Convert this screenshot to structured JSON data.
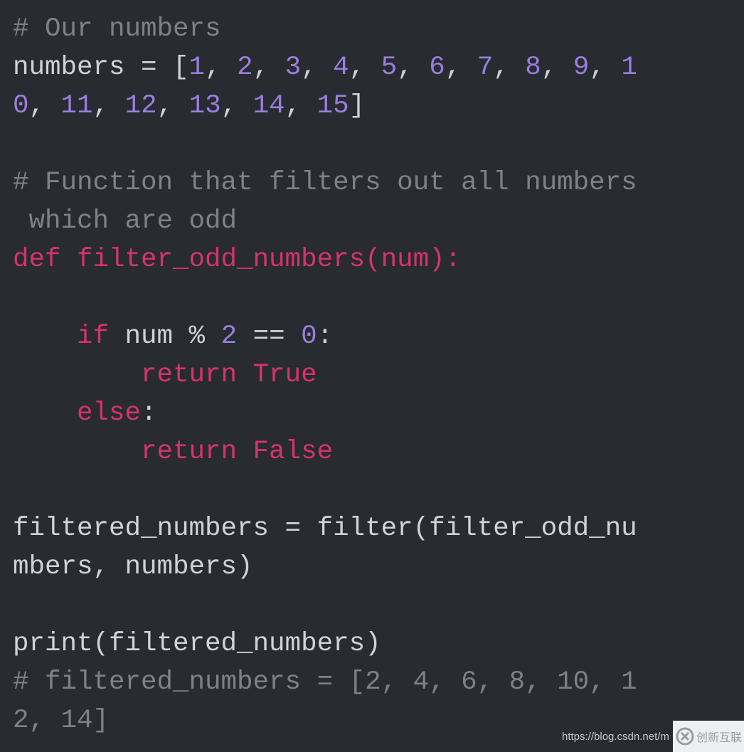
{
  "code_lines": [
    [
      {
        "t": "# Our numbers",
        "c": "cm"
      }
    ],
    [
      {
        "t": "numbers = [",
        "c": "pl"
      },
      {
        "t": "1",
        "c": "nm"
      },
      {
        "t": ", ",
        "c": "pl"
      },
      {
        "t": "2",
        "c": "nm"
      },
      {
        "t": ", ",
        "c": "pl"
      },
      {
        "t": "3",
        "c": "nm"
      },
      {
        "t": ", ",
        "c": "pl"
      },
      {
        "t": "4",
        "c": "nm"
      },
      {
        "t": ", ",
        "c": "pl"
      },
      {
        "t": "5",
        "c": "nm"
      },
      {
        "t": ", ",
        "c": "pl"
      },
      {
        "t": "6",
        "c": "nm"
      },
      {
        "t": ", ",
        "c": "pl"
      },
      {
        "t": "7",
        "c": "nm"
      },
      {
        "t": ", ",
        "c": "pl"
      },
      {
        "t": "8",
        "c": "nm"
      },
      {
        "t": ", ",
        "c": "pl"
      },
      {
        "t": "9",
        "c": "nm"
      },
      {
        "t": ", ",
        "c": "pl"
      },
      {
        "t": "1",
        "c": "nm"
      }
    ],
    [
      {
        "t": "0",
        "c": "nm"
      },
      {
        "t": ", ",
        "c": "pl"
      },
      {
        "t": "11",
        "c": "nm"
      },
      {
        "t": ", ",
        "c": "pl"
      },
      {
        "t": "12",
        "c": "nm"
      },
      {
        "t": ", ",
        "c": "pl"
      },
      {
        "t": "13",
        "c": "nm"
      },
      {
        "t": ", ",
        "c": "pl"
      },
      {
        "t": "14",
        "c": "nm"
      },
      {
        "t": ", ",
        "c": "pl"
      },
      {
        "t": "15",
        "c": "nm"
      },
      {
        "t": "]",
        "c": "pl"
      }
    ],
    [],
    [
      {
        "t": "# Function that filters out all numbers",
        "c": "cm"
      }
    ],
    [
      {
        "t": " which are odd",
        "c": "cm"
      }
    ],
    [
      {
        "t": "def filter_odd_numbers(num):",
        "c": "kw"
      }
    ],
    [],
    [
      {
        "t": "    ",
        "c": "pl"
      },
      {
        "t": "if",
        "c": "kw"
      },
      {
        "t": " num % ",
        "c": "pl"
      },
      {
        "t": "2",
        "c": "nm"
      },
      {
        "t": " == ",
        "c": "pl"
      },
      {
        "t": "0",
        "c": "nm"
      },
      {
        "t": ":",
        "c": "pl"
      }
    ],
    [
      {
        "t": "        ",
        "c": "pl"
      },
      {
        "t": "return True",
        "c": "kw"
      }
    ],
    [
      {
        "t": "    ",
        "c": "pl"
      },
      {
        "t": "else",
        "c": "kw"
      },
      {
        "t": ":",
        "c": "pl"
      }
    ],
    [
      {
        "t": "        ",
        "c": "pl"
      },
      {
        "t": "return False",
        "c": "kw"
      }
    ],
    [],
    [
      {
        "t": "filtered_numbers = filter(filter_odd_nu",
        "c": "pl"
      }
    ],
    [
      {
        "t": "mbers, numbers)",
        "c": "pl"
      }
    ],
    [],
    [
      {
        "t": "print(filtered_numbers)",
        "c": "pl"
      }
    ],
    [
      {
        "t": "# filtered_numbers = [2, 4, 6, 8, 10, 1",
        "c": "cm"
      }
    ],
    [
      {
        "t": "2, 14]",
        "c": "cm"
      }
    ]
  ],
  "watermark": {
    "url": "https://blog.csdn.net/m",
    "logo_text": "创新互联"
  },
  "colors": {
    "background": "#282b2f",
    "comment": "#7e8185",
    "keyword": "#d6336c",
    "number": "#9b7ee0",
    "plain": "#cfd3d9"
  }
}
